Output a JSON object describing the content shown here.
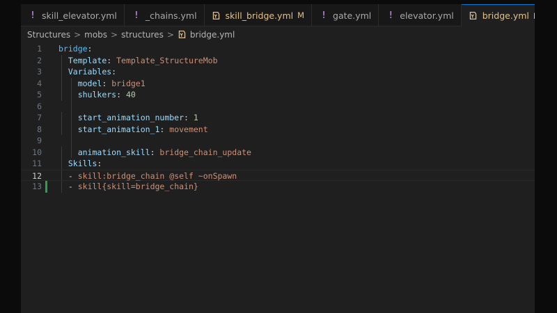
{
  "tabs": [
    {
      "label": "skill_elevator.yml",
      "icon": "yaml-exclamation-icon",
      "active": false,
      "modified": ""
    },
    {
      "label": "_chains.yml",
      "icon": "yaml-exclamation-icon",
      "active": false,
      "modified": ""
    },
    {
      "label": "skill_bridge.yml",
      "icon": "yaml-file-icon",
      "active": false,
      "modified": "M"
    },
    {
      "label": "gate.yml",
      "icon": "yaml-exclamation-icon",
      "active": false,
      "modified": ""
    },
    {
      "label": "elevator.yml",
      "icon": "yaml-exclamation-icon",
      "active": false,
      "modified": ""
    },
    {
      "label": "bridge.yml",
      "icon": "yaml-file-icon",
      "active": true,
      "modified": "M"
    }
  ],
  "close_glyph": "✕",
  "breadcrumb": {
    "parts": [
      "Structures",
      "mobs",
      "structures"
    ],
    "separator": ">",
    "file": "bridge.yml"
  },
  "editor": {
    "current_line": 12,
    "modified_line": 13,
    "lines": [
      {
        "n": "1",
        "segs": [
          {
            "t": "bridge",
            "c": "k1"
          },
          {
            "t": ":",
            "c": "pun"
          }
        ]
      },
      {
        "n": "2",
        "segs": [
          {
            "t": "  "
          },
          {
            "t": "Template",
            "c": "key"
          },
          {
            "t": ": ",
            "c": "pun"
          },
          {
            "t": "Template_StructureMob",
            "c": "str"
          }
        ]
      },
      {
        "n": "3",
        "segs": [
          {
            "t": "  "
          },
          {
            "t": "Variables",
            "c": "key"
          },
          {
            "t": ":",
            "c": "pun"
          }
        ]
      },
      {
        "n": "4",
        "segs": [
          {
            "t": "    "
          },
          {
            "t": "model",
            "c": "key"
          },
          {
            "t": ": ",
            "c": "pun"
          },
          {
            "t": "bridge1",
            "c": "str"
          }
        ]
      },
      {
        "n": "5",
        "segs": [
          {
            "t": "    "
          },
          {
            "t": "shulkers",
            "c": "key"
          },
          {
            "t": ": ",
            "c": "pun"
          },
          {
            "t": "40",
            "c": "num"
          }
        ]
      },
      {
        "n": "6",
        "segs": []
      },
      {
        "n": "7",
        "segs": [
          {
            "t": "    "
          },
          {
            "t": "start_animation_number",
            "c": "key"
          },
          {
            "t": ": ",
            "c": "pun"
          },
          {
            "t": "1",
            "c": "num"
          }
        ]
      },
      {
        "n": "8",
        "segs": [
          {
            "t": "    "
          },
          {
            "t": "start_animation_1",
            "c": "key"
          },
          {
            "t": ": ",
            "c": "pun"
          },
          {
            "t": "movement",
            "c": "str"
          }
        ]
      },
      {
        "n": "9",
        "segs": []
      },
      {
        "n": "10",
        "segs": [
          {
            "t": "    "
          },
          {
            "t": "animation_skill",
            "c": "key"
          },
          {
            "t": ": ",
            "c": "pun"
          },
          {
            "t": "bridge_chain_update",
            "c": "str"
          }
        ]
      },
      {
        "n": "11",
        "segs": [
          {
            "t": "  "
          },
          {
            "t": "Skills",
            "c": "key"
          },
          {
            "t": ":",
            "c": "pun"
          }
        ]
      },
      {
        "n": "12",
        "segs": [
          {
            "t": "  "
          },
          {
            "t": "- ",
            "c": "pun"
          },
          {
            "t": "skill:bridge_chain @self ~onSpawn",
            "c": "plain"
          }
        ]
      },
      {
        "n": "13",
        "segs": [
          {
            "t": "  "
          },
          {
            "t": "- ",
            "c": "pun"
          },
          {
            "t": "skill{skill=bridge_chain}",
            "c": "plain"
          }
        ]
      }
    ]
  },
  "colors": {
    "background": "#1f1f1f",
    "tab_bar": "#181818",
    "active_tab_border": "#0078d4",
    "modified_badge": "#e2c08d",
    "yaml_icon": "#b180d7",
    "gutter_added": "#2ea043"
  }
}
